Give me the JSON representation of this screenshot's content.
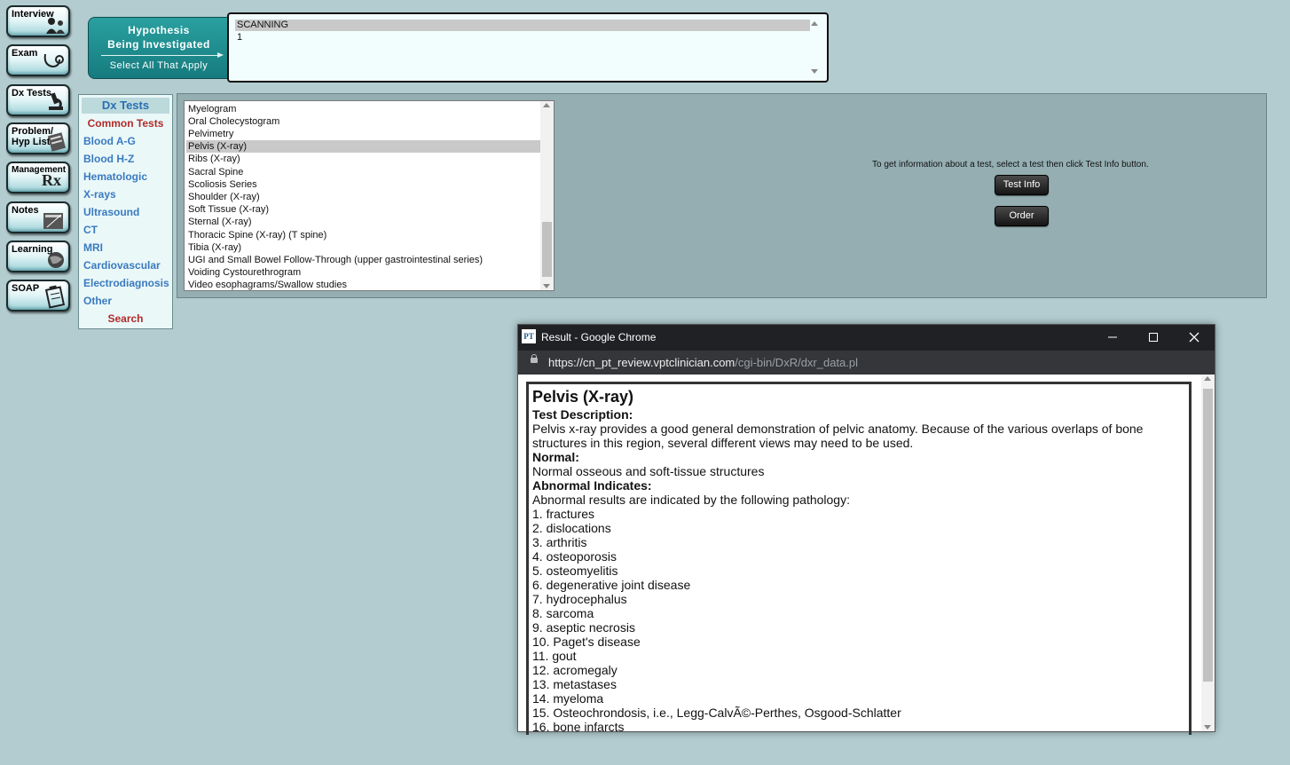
{
  "nav": [
    {
      "label": "Interview",
      "icon": "interview-icon"
    },
    {
      "label": "Exam",
      "icon": "stethoscope-icon"
    },
    {
      "label": "Dx Tests",
      "icon": "microscope-icon"
    },
    {
      "label": "Problem/ Hyp List",
      "icon": "clipboard-icon"
    },
    {
      "label": "Management",
      "sub": "Rx",
      "icon": "rx-icon"
    },
    {
      "label": "Notes",
      "icon": "notepad-icon"
    },
    {
      "label": "Learning",
      "icon": "globe-icon"
    },
    {
      "label": "SOAP",
      "icon": "soap-clipboard-icon"
    }
  ],
  "hypothesis": {
    "title_line1": "Hypothesis",
    "title_line2": "Being Investigated",
    "subtitle": "Select All That Apply",
    "options": [
      "SCANNING",
      "1"
    ],
    "selected_index": 0
  },
  "categories": {
    "header": "Dx Tests",
    "items": [
      "Common Tests",
      "Blood A-G",
      "Blood H-Z",
      "Hematologic",
      "X-rays",
      "Ultrasound",
      "CT",
      "MRI",
      "Cardiovascular",
      "Electrodiagnosis",
      "Other",
      "Search"
    ]
  },
  "tests": {
    "items": [
      "Myelogram",
      "Oral Cholecystogram",
      "Pelvimetry",
      "Pelvis (X-ray)",
      "Ribs (X-ray)",
      "Sacral Spine",
      "Scoliosis Series",
      "Shoulder (X-ray)",
      "Soft Tissue (X-ray)",
      "Sternal (X-ray)",
      "Thoracic Spine (X-ray) (T spine)",
      "Tibia (X-ray)",
      "UGI and Small Bowel Follow-Through (upper gastrointestinal series)",
      "Voiding Cystourethrogram",
      "Video esophagrams/Swallow studies"
    ],
    "selected": "Pelvis (X-ray)",
    "hint": "To get information about a test, select a test then click Test Info button.",
    "info_button": "Test Info",
    "order_button": "Order"
  },
  "popup": {
    "logo": "PT",
    "window_title": "Result - Google Chrome",
    "url_host": "https://cn_pt_review.vptclinician.com",
    "url_path": "/cgi-bin/DxR/dxr_data.pl",
    "heading": "Pelvis (X-ray)",
    "description_label": "Test Description:",
    "description": "Pelvis x-ray provides a good general demonstration of pelvic anatomy. Because of the various overlaps of bone structures in this region, several different views may need to be used.",
    "normal_label": "Normal:",
    "normal": "Normal osseous and soft-tissue structures",
    "abnormal_label": "Abnormal Indicates:",
    "abnormal_intro": "Abnormal results are indicated by the following pathology:",
    "abnormal_items": [
      "1. fractures",
      "2. dislocations",
      "3. arthritis",
      "4. osteoporosis",
      "5. osteomyelitis",
      "6. degenerative joint disease",
      "7. hydrocephalus",
      "8. sarcoma",
      "9. aseptic necrosis",
      "10. Paget's disease",
      "11. gout",
      "12. acromegaly",
      "13. metastases",
      "14. myeloma",
      "15. Osteochrondosis, i.e., Legg-CalvÃ©-Perthes, Osgood-Schlatter",
      "16. bone infarcts"
    ]
  }
}
